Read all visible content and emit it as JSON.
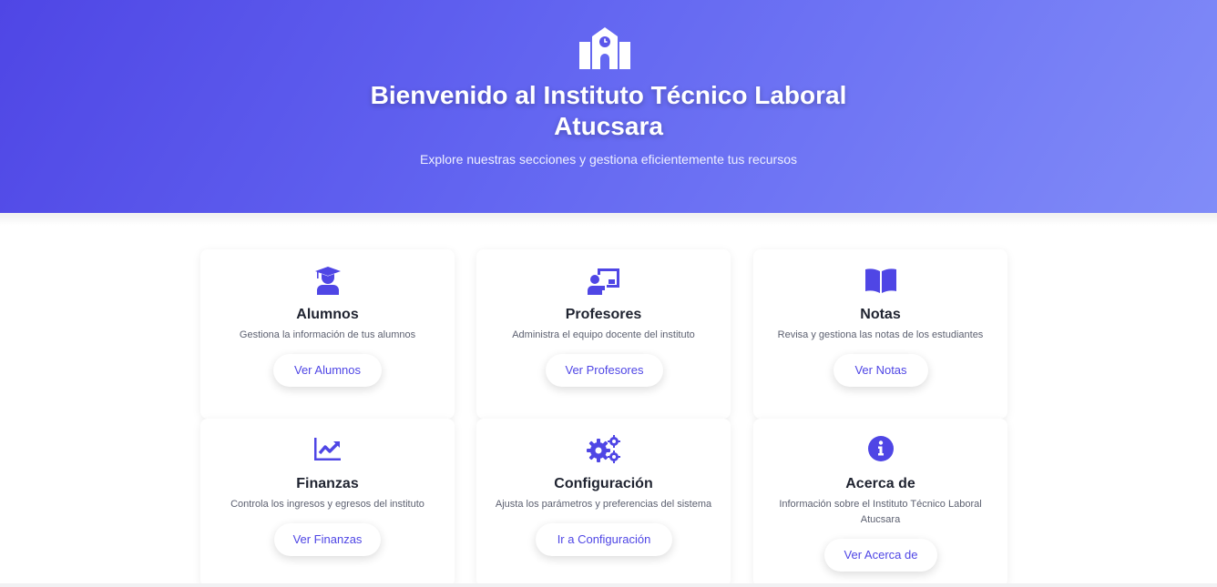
{
  "hero": {
    "title": "Bienvenido al Instituto Técnico Laboral Atucsara",
    "subtitle": "Explore nuestras secciones y gestiona eficientemente tus recursos",
    "logo_icon": "school-icon"
  },
  "colors": {
    "accent": "#4f46e5",
    "hero_start": "#4f46e5",
    "hero_end": "#818cf8"
  },
  "cards": [
    {
      "icon": "graduate-icon",
      "title": "Alumnos",
      "desc": "Gestiona la información de tus alumnos",
      "button": "Ver Alumnos"
    },
    {
      "icon": "teacher-icon",
      "title": "Profesores",
      "desc": "Administra el equipo docente del instituto",
      "button": "Ver Profesores"
    },
    {
      "icon": "book-icon",
      "title": "Notas",
      "desc": "Revisa y gestiona las notas de los estudiantes",
      "button": "Ver Notas"
    },
    {
      "icon": "chart-line-icon",
      "title": "Finanzas",
      "desc": "Controla los ingresos y egresos del instituto",
      "button": "Ver Finanzas"
    },
    {
      "icon": "gears-icon",
      "title": "Configuración",
      "desc": "Ajusta los parámetros y preferencias del sistema",
      "button": "Ir a Configuración"
    },
    {
      "icon": "info-icon",
      "title": "Acerca de",
      "desc": "Información sobre el Instituto Técnico Laboral Atucsara",
      "button": "Ver Acerca de"
    }
  ]
}
